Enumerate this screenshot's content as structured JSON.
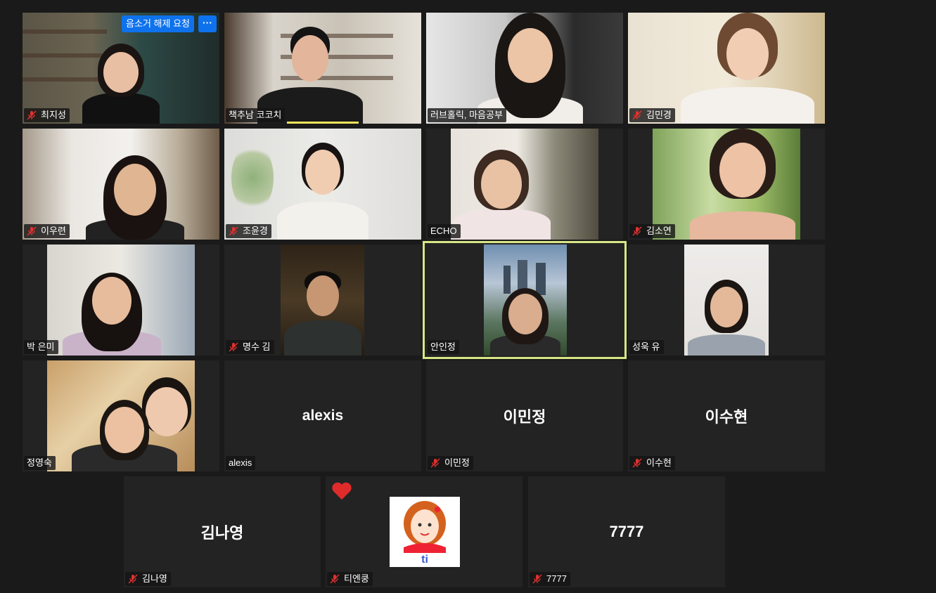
{
  "participants": [
    {
      "name": "최지성",
      "muted": true,
      "camera": true
    },
    {
      "name": "책추남 코코치",
      "muted": false,
      "camera": true,
      "speaking": true
    },
    {
      "name": "러브홀릭, 마음공부",
      "muted": false,
      "camera": true
    },
    {
      "name": "김민경",
      "muted": true,
      "camera": true
    },
    {
      "name": "이우련",
      "muted": true,
      "camera": true
    },
    {
      "name": "조윤경",
      "muted": true,
      "camera": true
    },
    {
      "name": "ECHO",
      "muted": false,
      "camera": true
    },
    {
      "name": "김소연",
      "muted": true,
      "camera": true
    },
    {
      "name": "박 은미",
      "muted": false,
      "camera": true
    },
    {
      "name": "명수 김",
      "muted": true,
      "camera": true
    },
    {
      "name": "안인정",
      "muted": false,
      "camera": true,
      "active": true
    },
    {
      "name": "성욱 유",
      "muted": false,
      "camera": true
    },
    {
      "name": "정영숙",
      "muted": false,
      "camera": true
    },
    {
      "name": "alexis",
      "muted": false,
      "camera": false,
      "display_name": "alexis"
    },
    {
      "name": "이민정",
      "muted": true,
      "camera": false,
      "display_name": "이민정"
    },
    {
      "name": "이수현",
      "muted": true,
      "camera": false,
      "display_name": "이수현"
    },
    {
      "name": "김나영",
      "muted": true,
      "camera": false,
      "display_name": "김나영"
    },
    {
      "name": "티엔쿵",
      "muted": true,
      "camera": false,
      "avatar": true,
      "reaction": "heart"
    },
    {
      "name": "7777",
      "muted": true,
      "camera": false,
      "display_name": "7777"
    }
  ],
  "controls": {
    "unmute_request_label": "음소거 해제 요청",
    "more_label": "···"
  },
  "colors": {
    "background": "#1a1a1a",
    "tile": "#232323",
    "active_border": "#d8e585",
    "muted_icon": "#e0312e",
    "button": "#0e72ed",
    "heart": "#e02b2b"
  },
  "icons": {
    "muted": "mic-muted-icon",
    "more": "more-options-icon",
    "reaction": "heart-icon"
  }
}
